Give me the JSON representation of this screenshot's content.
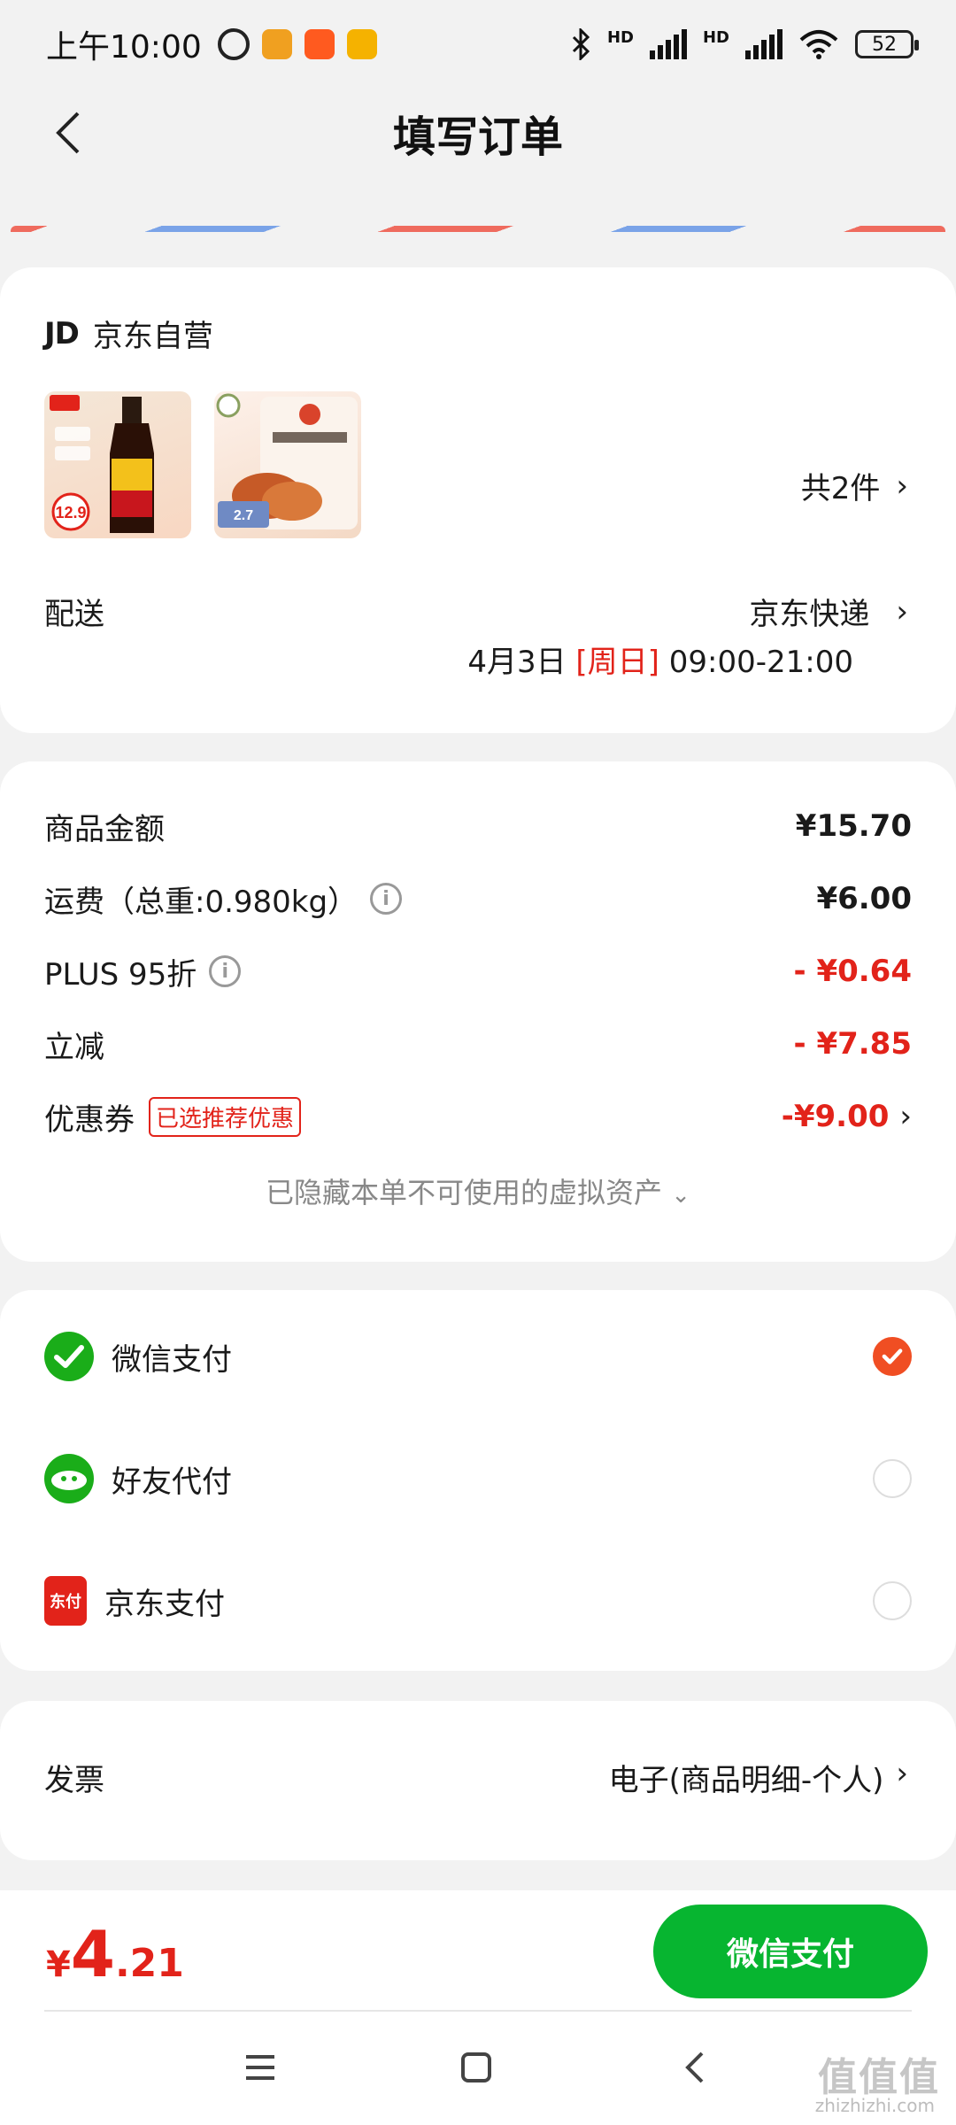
{
  "status_bar": {
    "time": "上午10:00",
    "battery": "52",
    "network_1": "HD",
    "network_2": "HD"
  },
  "header": {
    "title": "填写订单"
  },
  "shop": {
    "logo": "JD",
    "name": "京东自营",
    "total_items": "共2件",
    "product_1_price_tag": "12.9",
    "product_2_price_tag": "2.7",
    "delivery_label": "配送",
    "delivery_carrier": "京东快递",
    "delivery_date": "4月3日",
    "delivery_weekday": "[周日]",
    "delivery_time": "09:00-21:00"
  },
  "pricing": {
    "goods_label": "商品金额",
    "goods_value": "¥15.70",
    "shipping_label": "运费（总重:0.980kg）",
    "shipping_value": "¥6.00",
    "plus_label": "PLUS 95折",
    "plus_value": "- ¥0.64",
    "instant_label": "立减",
    "instant_value": "- ¥7.85",
    "coupon_label": "优惠券",
    "coupon_tag": "已选推荐优惠",
    "coupon_value": "-¥9.00",
    "hidden_assets": "已隐藏本单不可使用的虚拟资产"
  },
  "payment": {
    "methods": [
      {
        "label": "微信支付",
        "selected": true
      },
      {
        "label": "好友代付",
        "selected": false
      },
      {
        "label": "京东支付",
        "selected": false
      }
    ],
    "jd_icon_text": "东付"
  },
  "invoice": {
    "label": "发票",
    "value": "电子(商品明细-个人)"
  },
  "footer": {
    "currency": "¥",
    "total_int": "4",
    "total_dec": ".21",
    "pay_button": "微信支付"
  },
  "watermark": {
    "text": "值值值",
    "sub": "zhizhizhi.com"
  },
  "colors": {
    "accent_red": "#e2231a",
    "wechat_green": "#07b530",
    "radio_orange": "#f04e23"
  }
}
